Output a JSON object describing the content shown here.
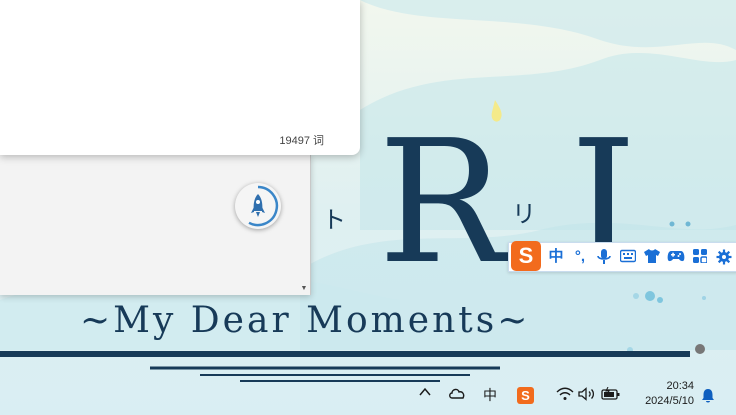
{
  "wallpaper": {
    "title_letter_1": "R",
    "title_letter_2": "I",
    "kana_left": "ト",
    "kana_right": "リ",
    "subtitle": "~My Dear Moments~"
  },
  "document": {
    "word_count": "19497 词"
  },
  "ime_toolbar": {
    "logo": "S",
    "mode_label": "中",
    "punct_label": "°,",
    "icons": [
      "microphone-icon",
      "keyboard-icon",
      "skin-shirt-icon",
      "gamepad-icon",
      "toolbox-icon",
      "settings-gear-icon"
    ],
    "accent_color": "#1a6fd6",
    "brand_color": "#f26b1d"
  },
  "taskbar": {
    "ime_mode": "中",
    "sogou_logo": "S",
    "time": "20:34",
    "date": "2024/5/10",
    "icons": [
      "chevron-up-icon",
      "onedrive-cloud-icon",
      "wifi-icon",
      "volume-icon",
      "battery-icon",
      "notification-bell-icon"
    ]
  }
}
